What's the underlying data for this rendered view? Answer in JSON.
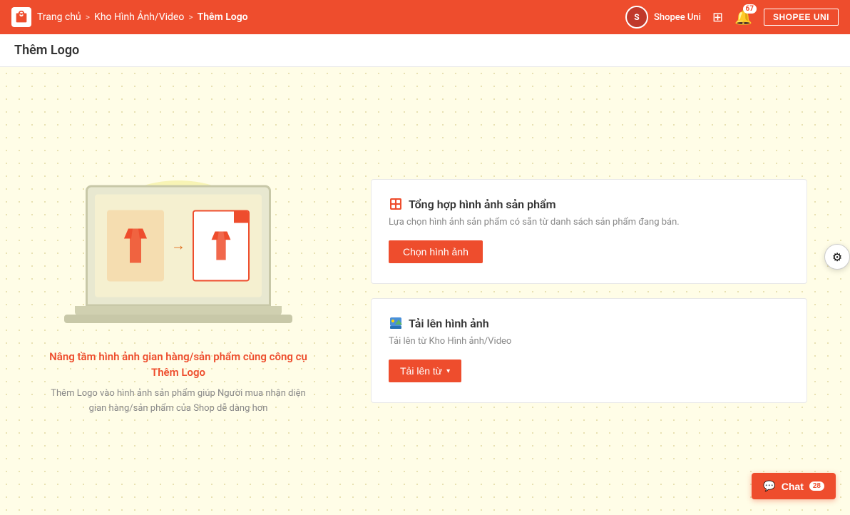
{
  "topnav": {
    "breadcrumb": {
      "home": "Trang chủ",
      "sep1": ">",
      "section": "Kho Hình Ảnh/Video",
      "sep2": ">",
      "current": "Thêm Logo"
    },
    "shopee_uni_label": "Shopee Uni",
    "notif_count": "67",
    "shopee_uni_btn": "SHOPEE UNI"
  },
  "sub_header": {
    "title": "Thêm Logo"
  },
  "illustration": {
    "title": "Nâng tầm hình ảnh gian hàng/sản phẩm cùng công cụ Thêm Logo",
    "subtitle": "Thêm Logo vào hình ảnh sản phẩm giúp Người mua nhận diện gian hàng/sản phẩm của Shop dễ dàng hơn"
  },
  "card1": {
    "title": "Tổng hợp hình ảnh sản phẩm",
    "desc": "Lựa chọn hình ảnh sản phẩm có sẵn từ danh sách sản phẩm đang bán.",
    "btn": "Chọn hình ảnh"
  },
  "card2": {
    "title": "Tải lên hình ảnh",
    "desc": "Tải lên từ Kho Hình ảnh/Video",
    "btn": "Tải lên từ",
    "btn_chevron": "▾"
  },
  "support": {
    "icon": "⚙"
  },
  "chat": {
    "label": "Chat",
    "badge": "28"
  }
}
